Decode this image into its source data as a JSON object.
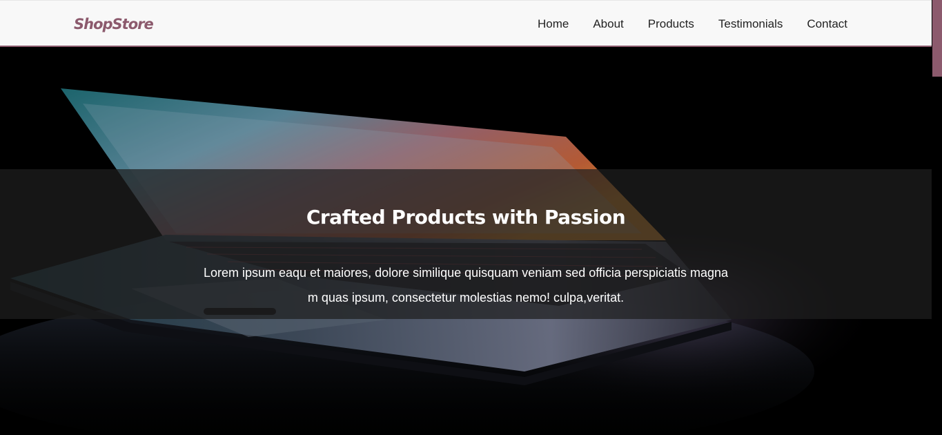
{
  "brand": {
    "name": "ShopStore"
  },
  "nav": {
    "items": [
      {
        "label": "Home"
      },
      {
        "label": "About"
      },
      {
        "label": "Products"
      },
      {
        "label": "Testimonials"
      },
      {
        "label": "Contact"
      }
    ]
  },
  "hero": {
    "title": "Crafted Products with Passion",
    "text": "Lorem ipsum eaqu et maiores, dolore similique quisquam veniam sed officia perspiciatis magna m quas ipsum, consectetur molestias nemo! culpa,veritat.",
    "image": "laptop-photo"
  },
  "colors": {
    "accent": "#8c5a6d",
    "navbar_bg": "#f8f8f8",
    "nav_text": "#222222",
    "hero_overlay": "rgba(30,30,30,0.72)"
  }
}
